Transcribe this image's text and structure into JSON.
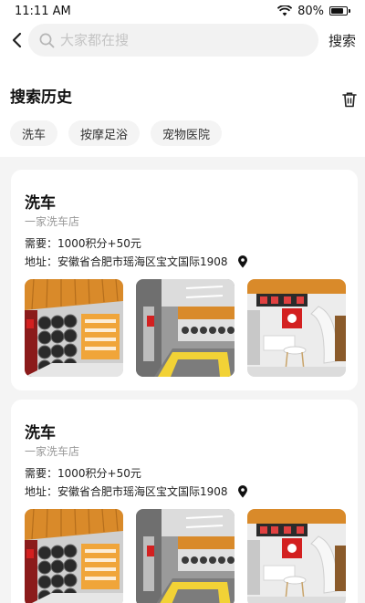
{
  "status_bar": {
    "time": "11:11 AM",
    "battery": "80%",
    "battery_level": 0.8
  },
  "search": {
    "placeholder": "大家都在搜",
    "value": "",
    "button_label": "搜索"
  },
  "history": {
    "title": "搜索历史",
    "chips": [
      "洗车",
      "按摩足浴",
      "宠物医院"
    ]
  },
  "listings": [
    {
      "title": "洗车",
      "subtitle": "一家洗车店",
      "requirement": "需要：1000积分+50元",
      "address": "地址：安徽省合肥市瑶海区宝文国际1908",
      "images": [
        "tire-shop-interior-image",
        "workshop-bay-image",
        "store-lounge-image"
      ]
    },
    {
      "title": "洗车",
      "subtitle": "一家洗车店",
      "requirement": "需要：1000积分+50元",
      "address": "地址：安徽省合肥市瑶海区宝文国际1908",
      "images": [
        "tire-shop-interior-image",
        "workshop-bay-image",
        "store-lounge-image"
      ]
    }
  ],
  "icons": {
    "back": "chevron-left-icon",
    "search": "search-icon",
    "trash": "trash-icon",
    "location": "location-pin-icon",
    "wifi": "wifi-icon",
    "battery": "battery-icon"
  },
  "colors": {
    "background": "#f4f4f4",
    "card": "#ffffff",
    "chip": "#f4f4f4",
    "muted_text": "#999999"
  }
}
